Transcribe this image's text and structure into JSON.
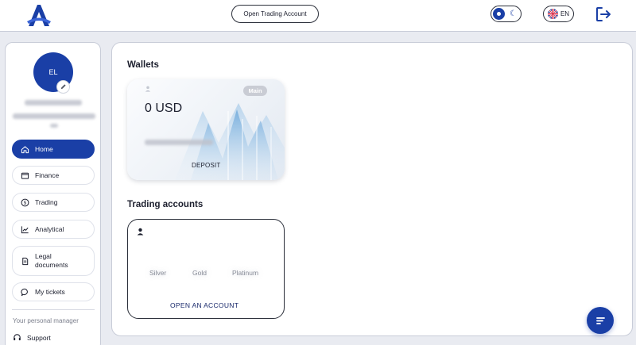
{
  "header": {
    "open_trading_account_label": "Open Trading Account",
    "language_label": "EN",
    "colors": {
      "brand": "#1a3fa6"
    }
  },
  "sidebar": {
    "avatar_initials": "EL",
    "nav": [
      {
        "label": "Home",
        "icon": "home-icon",
        "active": true
      },
      {
        "label": "Finance",
        "icon": "wallet-icon"
      },
      {
        "label": "Trading",
        "icon": "dollar-icon"
      },
      {
        "label": "Analytical",
        "icon": "chart-icon"
      },
      {
        "label": "Legal documents",
        "icon": "document-icon"
      },
      {
        "label": "My tickets",
        "icon": "chat-icon"
      }
    ],
    "personal_manager_label": "Your personal manager",
    "support_label": "Support"
  },
  "wallets": {
    "title": "Wallets",
    "card": {
      "badge": "Main",
      "amount": "0 USD",
      "deposit_label": "DEPOSIT"
    }
  },
  "trading_accounts": {
    "title": "Trading accounts",
    "tiers": [
      "Silver",
      "Gold",
      "Platinum"
    ],
    "open_account_label": "OPEN AN ACCOUNT"
  }
}
